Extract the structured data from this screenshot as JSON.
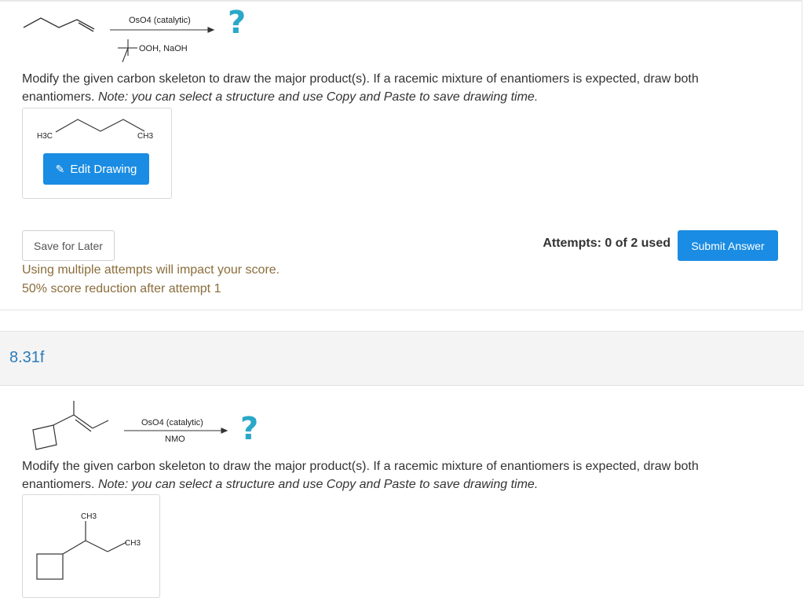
{
  "question1": {
    "reagent_top": "OsO4 (catalytic)",
    "reagent_bottom": "OOH, NaOH",
    "question_mark": "?",
    "instruction_main": "Modify the given carbon skeleton to draw the major product(s). If a racemic mixture of enantiomers is expected, draw both enantiomers.",
    "instruction_note": "Note: you can select a structure and use Copy and Paste to save drawing time.",
    "skeleton_left_label": "H3C",
    "skeleton_right_label": "CH3",
    "edit_button_label": "Edit Drawing",
    "save_button_label": "Save for Later",
    "attempts_label": "Attempts: 0 of 2 used",
    "submit_button_label": "Submit Answer",
    "warning_line1": "Using multiple attempts will impact your score.",
    "warning_line2": "50% score reduction after attempt 1"
  },
  "question2": {
    "number": "8.31f",
    "reagent_top": "OsO4 (catalytic)",
    "reagent_bottom": "NMO",
    "question_mark": "?",
    "instruction_main": "Modify the given carbon skeleton to draw the major product(s). If a racemic mixture of enantiomers is expected, draw both enantiomers.",
    "instruction_note": "Note: you can select a structure and use Copy and Paste to save drawing time.",
    "skeleton_top_label": "CH3",
    "skeleton_right_label": "CH3"
  },
  "colors": {
    "primary_button": "#1a8ce3",
    "question_mark": "#2aa8c8",
    "warning_text": "#8a6d3b",
    "question_number": "#2b7bb9"
  },
  "icons": {
    "edit": "pencil-icon"
  }
}
